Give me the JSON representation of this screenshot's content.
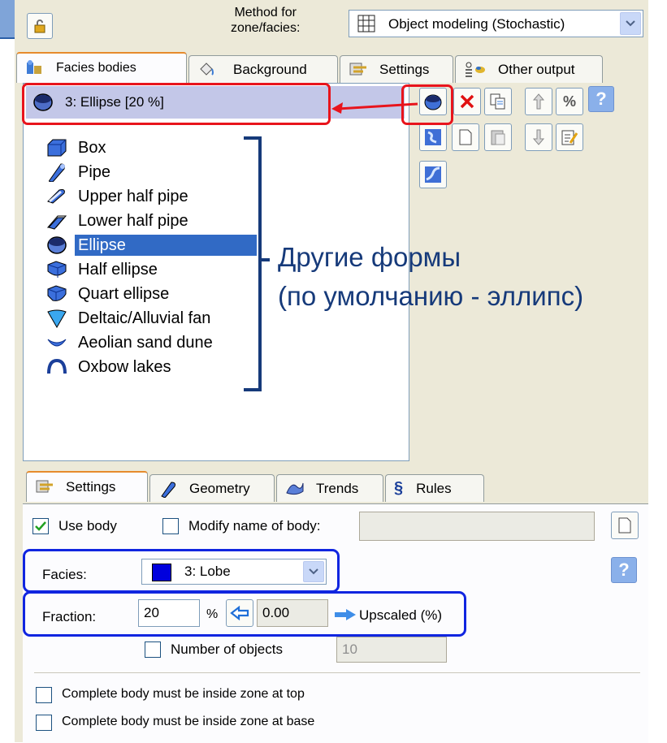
{
  "header": {
    "method_label": "Method for\nzone/facies:",
    "method_value": "Object modeling (Stochastic)"
  },
  "top_tabs": [
    {
      "label": "Facies bodies",
      "active": true
    },
    {
      "label": "Background",
      "active": false
    },
    {
      "label": "Settings",
      "active": false
    },
    {
      "label": "Other output",
      "active": false
    }
  ],
  "body_list": {
    "items": [
      {
        "label": "3: Ellipse [20 %]",
        "selected": true
      }
    ]
  },
  "shape_list": {
    "items": [
      {
        "label": "Box",
        "icon": "box-icon"
      },
      {
        "label": "Pipe",
        "icon": "pipe-icon"
      },
      {
        "label": "Upper half pipe",
        "icon": "upper-half-pipe-icon"
      },
      {
        "label": "Lower half pipe",
        "icon": "lower-half-pipe-icon"
      },
      {
        "label": "Ellipse",
        "icon": "ellipse-icon",
        "selected": true
      },
      {
        "label": "Half ellipse",
        "icon": "half-ellipse-icon"
      },
      {
        "label": "Quart ellipse",
        "icon": "quart-ellipse-icon"
      },
      {
        "label": "Deltaic/Alluvial fan",
        "icon": "deltaic-fan-icon"
      },
      {
        "label": "Aeolian sand dune",
        "icon": "aeolian-dune-icon"
      },
      {
        "label": "Oxbow lakes",
        "icon": "oxbow-lakes-icon"
      }
    ]
  },
  "annotation": {
    "line1": "Другие формы",
    "line2": "(по умолчанию - эллипс)",
    "color": "#163a7a"
  },
  "bottom_tabs": [
    {
      "label": "Settings",
      "active": true
    },
    {
      "label": "Geometry",
      "active": false
    },
    {
      "label": "Trends",
      "active": false
    },
    {
      "label": "Rules",
      "active": false
    }
  ],
  "settings": {
    "use_body": {
      "label": "Use body",
      "checked": true
    },
    "modify_name": {
      "label": "Modify name of body:",
      "checked": false,
      "value": ""
    },
    "facies": {
      "label": "Facies:",
      "value": "3: Lobe",
      "swatch": "#0000dd"
    },
    "fraction": {
      "label": "Fraction:",
      "value": "20",
      "unit": "%",
      "upscaled_value": "0.00",
      "upscaled_label": "Upscaled (%)"
    },
    "number_of_objects": {
      "label": "Number of objects",
      "checked": false,
      "value": "10"
    },
    "inside_top": {
      "label": "Complete body must be inside zone at top",
      "checked": false
    },
    "inside_base": {
      "label": "Complete body must be inside zone at base",
      "checked": false
    }
  },
  "colors": {
    "accent_red": "#e8141c",
    "accent_blue": "#1025e0",
    "selection": "#316ac5",
    "window": "#ece9d8"
  }
}
